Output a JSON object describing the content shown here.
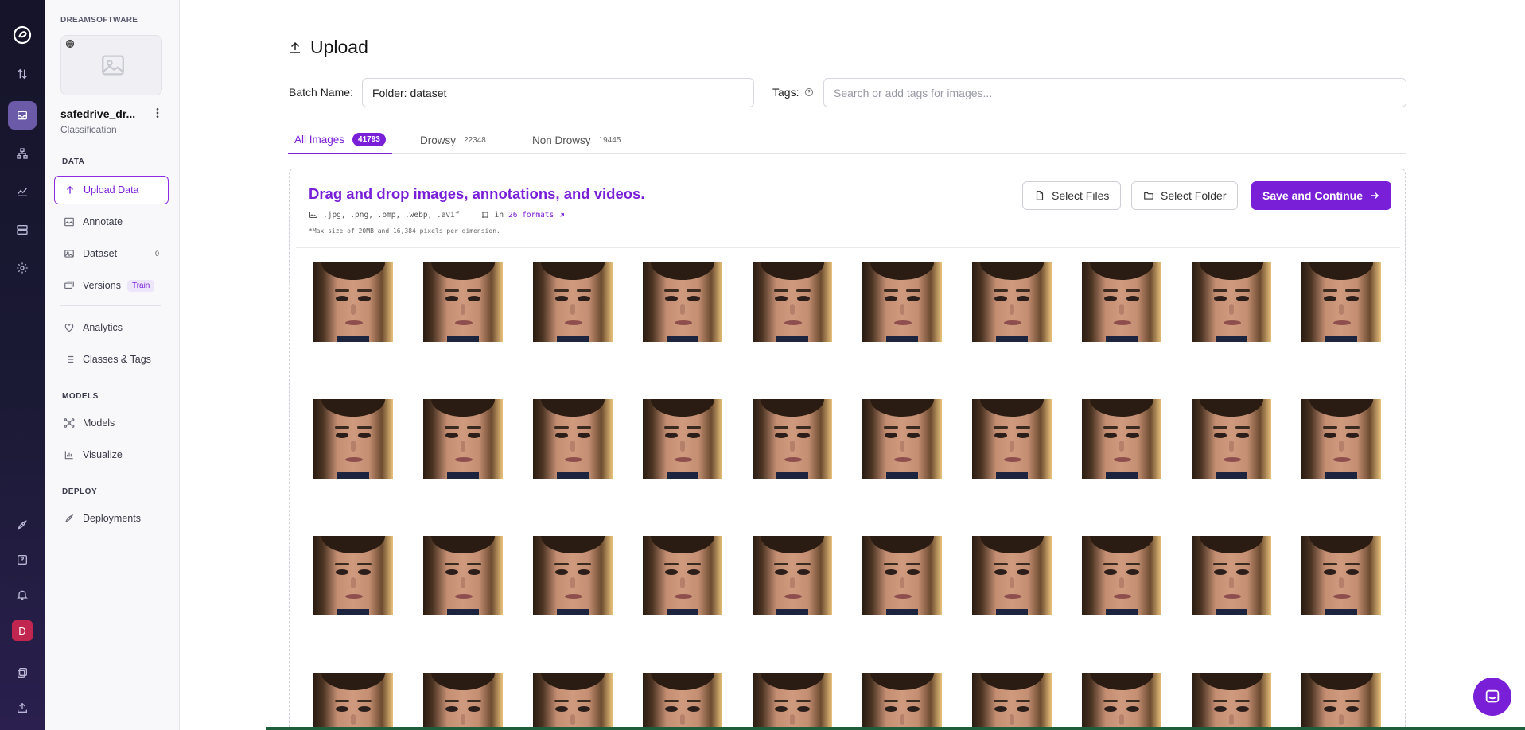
{
  "workspace": "DREAMSOFTWARE",
  "project": {
    "name": "safedrive_dr...",
    "type": "Classification"
  },
  "sidebar": {
    "sections": {
      "data": "DATA",
      "models": "MODELS",
      "deploy": "DEPLOY"
    },
    "items": [
      {
        "label": "Upload Data",
        "icon": "arrow-up-icon",
        "active": true
      },
      {
        "label": "Annotate",
        "icon": "annotate-icon"
      },
      {
        "label": "Dataset",
        "icon": "image-icon",
        "count": "0"
      },
      {
        "label": "Versions",
        "icon": "layers-icon",
        "pill": "Train"
      },
      {
        "label": "Analytics",
        "icon": "heart-icon"
      },
      {
        "label": "Classes & Tags",
        "icon": "list-icon"
      },
      {
        "label": "Models",
        "icon": "model-icon"
      },
      {
        "label": "Visualize",
        "icon": "chart-icon"
      },
      {
        "label": "Deployments",
        "icon": "rocket-icon"
      }
    ]
  },
  "rail": {
    "avatar_letter": "D"
  },
  "page": {
    "title": "Upload",
    "batch_label": "Batch Name:",
    "batch_value": "Folder: dataset",
    "tags_label": "Tags:",
    "tags_placeholder": "Search or add tags for images..."
  },
  "tabs": [
    {
      "label": "All Images",
      "count": "41793",
      "active": true
    },
    {
      "label": "Drowsy",
      "count": "22348"
    },
    {
      "label": "Non Drowsy",
      "count": "19445"
    }
  ],
  "dropzone": {
    "title": "Drag and drop images, annotations, and videos.",
    "formats": ".jpg, .png, .bmp, .webp, .avif",
    "formats_in": "in",
    "formats_link": "26 formats",
    "max_size": "*Max size of 20MB and 16,384 pixels per dimension.",
    "select_files": "Select Files",
    "select_folder": "Select Folder",
    "save_continue": "Save and Continue"
  },
  "colors": {
    "accent": "#7a1fd8",
    "rail_bg": "#15142a",
    "avatar": "#c0264f"
  }
}
